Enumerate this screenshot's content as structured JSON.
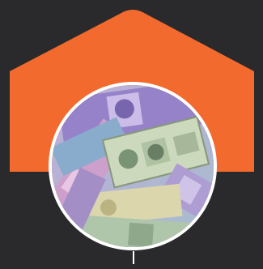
{
  "colors": {
    "background": "#2a2a2c",
    "accent": "#f26a2e",
    "ring": "#ffffff"
  },
  "badge": {
    "icon": "house-badge-icon",
    "image": "banknotes-photo"
  }
}
